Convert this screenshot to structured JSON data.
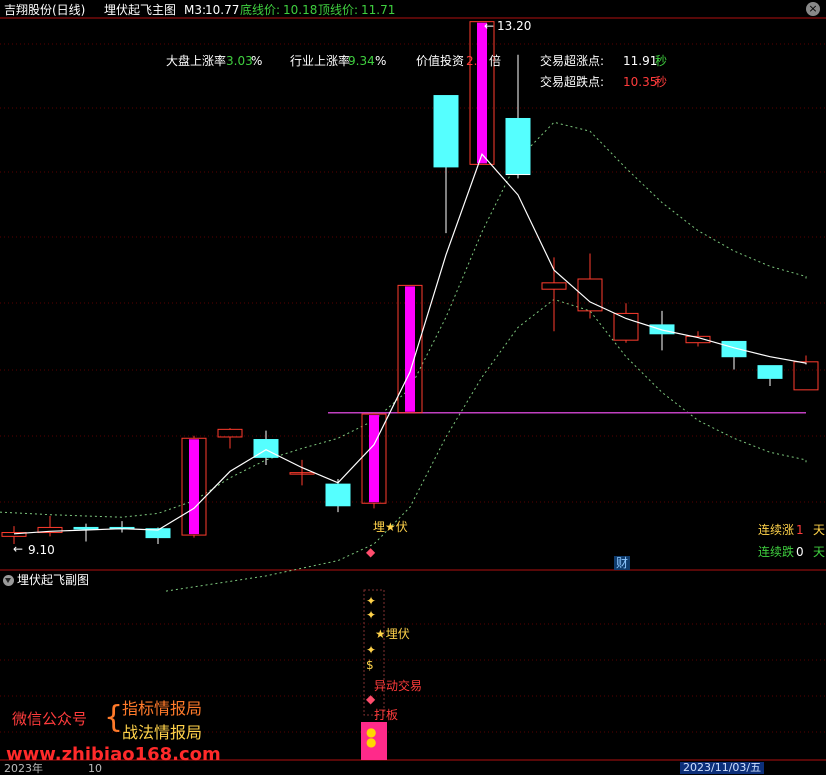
{
  "header": {
    "stock": "吉翔股份(日线)",
    "indicator": "埋伏起飞主图",
    "m3_label": "M3:",
    "m3_value": "10.77",
    "bottom_label": "底线价:",
    "bottom_value": "10.18",
    "top_label": "顶线价:",
    "top_value": "11.71"
  },
  "info_panel": {
    "market_up_label": "大盘上涨率",
    "market_up_value": "3.03",
    "industry_up_label": "行业上涨率",
    "industry_up_value": "9.34",
    "value_invest_label": "价值投资",
    "value_invest_value": "2.",
    "value_invest_unit": "倍",
    "percent": "%",
    "overbought_label": "交易超涨点:",
    "overbought_value": "11.91",
    "overbought_unit": "秒",
    "oversold_label": "交易超跌点:",
    "oversold_value": "10.35",
    "oversold_unit": "秒"
  },
  "annotations": {
    "high_label": "13.20",
    "low_label": "9.10",
    "ambush": "埋★伏",
    "cai": "财",
    "streak_up_label": "连续涨",
    "streak_up_value": "1",
    "streak_up_unit": "天",
    "streak_down_label": "连续跌",
    "streak_down_value": "0",
    "streak_down_unit": "天"
  },
  "sub_chart": {
    "title": "埋伏起飞副图",
    "ambush": "★埋伏",
    "abnormal": "异动交易",
    "board": "打板"
  },
  "watermark": {
    "wechat": "微信公众号",
    "line1": "指标情报局",
    "line2": "战法情报局",
    "site": "www.zhibiao168.com"
  },
  "axis": {
    "year": "2023年",
    "month": "10",
    "date": "2023/11/03/五"
  },
  "colors": {
    "up": "#ff3c2e",
    "up_body": "#ff00ff",
    "down": "#55ffff",
    "ma": "#ffffff",
    "band": "#7ec87e",
    "support": "#c040c0",
    "grid": "#5a0000",
    "separator": "#b01010"
  },
  "chart_data": {
    "type": "candlestick",
    "candles": [
      {
        "o": 9.16,
        "h": 9.24,
        "l": 9.1,
        "c": 9.19
      },
      {
        "o": 9.19,
        "h": 9.32,
        "l": 9.16,
        "c": 9.23
      },
      {
        "o": 9.23,
        "h": 9.26,
        "l": 9.12,
        "c": 9.22
      },
      {
        "o": 9.23,
        "h": 9.28,
        "l": 9.19,
        "c": 9.22
      },
      {
        "o": 9.22,
        "h": 9.23,
        "l": 9.1,
        "c": 9.15
      },
      {
        "o": 9.17,
        "h": 9.95,
        "l": 9.15,
        "c": 9.93
      },
      {
        "o": 9.94,
        "h": 10.01,
        "l": 9.85,
        "c": 10.0
      },
      {
        "o": 9.92,
        "h": 9.99,
        "l": 9.72,
        "c": 9.78
      },
      {
        "o": 9.66,
        "h": 9.76,
        "l": 9.56,
        "c": 9.66
      },
      {
        "o": 9.57,
        "h": 9.61,
        "l": 9.35,
        "c": 9.4
      },
      {
        "o": 9.42,
        "h": 10.13,
        "l": 9.38,
        "c": 10.12
      },
      {
        "o": 10.13,
        "h": 11.13,
        "l": 10.13,
        "c": 11.13
      },
      {
        "o": 12.62,
        "h": 12.62,
        "l": 11.54,
        "c": 12.06
      },
      {
        "o": 12.08,
        "h": 13.2,
        "l": 12.08,
        "c": 13.2
      },
      {
        "o": 12.44,
        "h": 12.94,
        "l": 11.97,
        "c": 12.0
      },
      {
        "o": 11.1,
        "h": 11.35,
        "l": 10.77,
        "c": 11.15
      },
      {
        "o": 10.93,
        "h": 11.38,
        "l": 10.87,
        "c": 11.18
      },
      {
        "o": 10.7,
        "h": 10.99,
        "l": 10.68,
        "c": 10.91
      },
      {
        "o": 10.82,
        "h": 10.93,
        "l": 10.62,
        "c": 10.75
      },
      {
        "o": 10.68,
        "h": 10.77,
        "l": 10.65,
        "c": 10.73
      },
      {
        "o": 10.69,
        "h": 10.69,
        "l": 10.47,
        "c": 10.57
      },
      {
        "o": 10.5,
        "h": 10.5,
        "l": 10.34,
        "c": 10.4
      },
      {
        "o": 10.31,
        "h": 10.58,
        "l": 10.31,
        "c": 10.53
      }
    ],
    "ma": [
      9.18,
      9.2,
      9.21,
      9.22,
      9.21,
      9.38,
      9.67,
      9.84,
      9.7,
      9.58,
      9.88,
      10.45,
      11.37,
      12.16,
      11.84,
      11.25,
      11.0,
      10.87,
      10.78,
      10.72,
      10.64,
      10.57,
      10.52
    ],
    "band_upper": [
      null,
      9.33,
      9.32,
      9.31,
      9.34,
      9.44,
      9.62,
      9.76,
      9.85,
      9.93,
      10.07,
      10.32,
      10.88,
      11.55,
      12.12,
      12.41,
      12.34,
      12.05,
      11.78,
      11.56,
      11.4,
      11.28,
      11.2
    ],
    "band_lower": [
      null,
      null,
      null,
      null,
      null,
      null,
      null,
      8.85,
      8.91,
      8.97,
      9.1,
      9.39,
      9.94,
      10.41,
      10.8,
      11.02,
      10.93,
      10.57,
      10.29,
      10.07,
      9.93,
      9.82,
      9.76
    ],
    "support_level": 10.13
  }
}
